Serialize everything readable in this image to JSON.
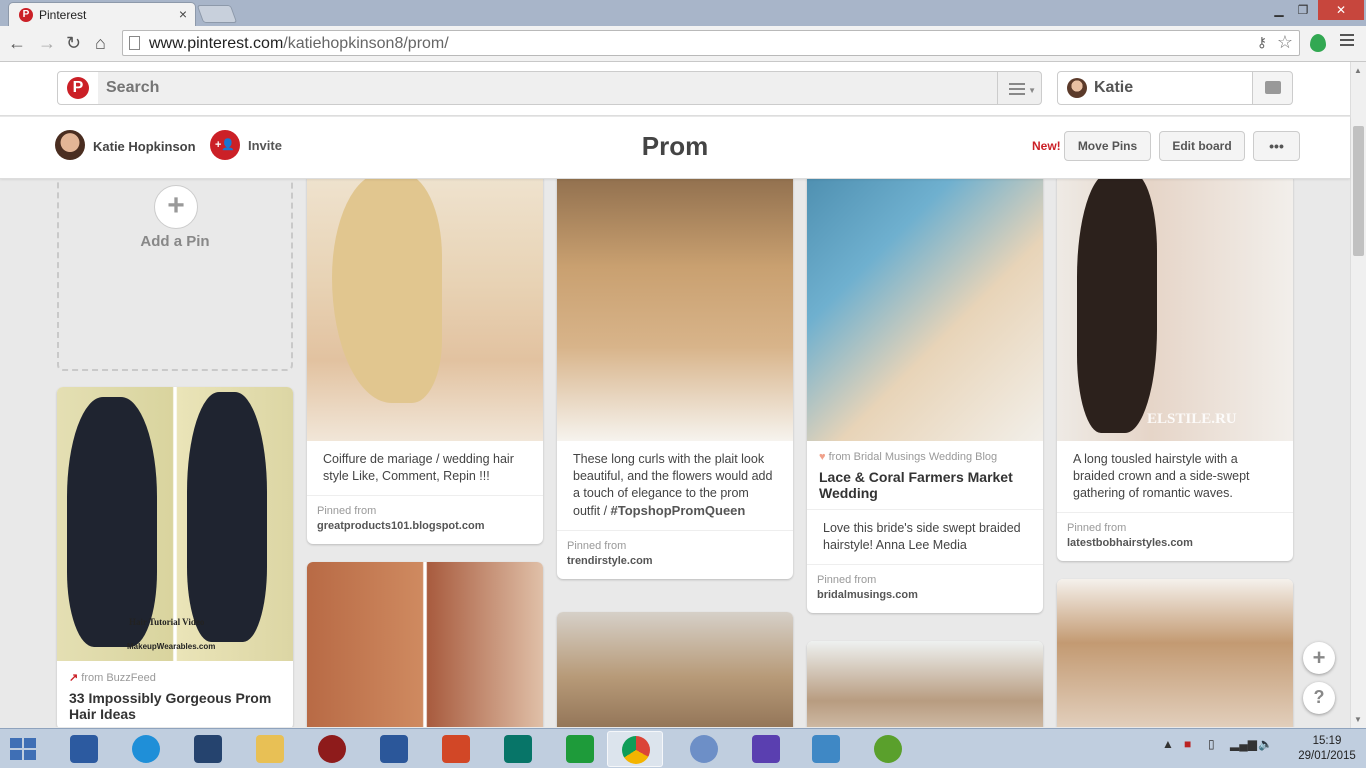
{
  "browser": {
    "tab_title": "Pinterest",
    "url_domain": "www.pinterest.com",
    "url_path": "/katiehopkinson8/prom/"
  },
  "header": {
    "search_placeholder": "Search",
    "user_name": "Katie"
  },
  "board": {
    "owner_name": "Katie Hopkinson",
    "invite_label": "Invite",
    "title": "Prom",
    "new_label": "New!",
    "move_pins_label": "Move Pins",
    "edit_board_label": "Edit board",
    "more_label": "•••"
  },
  "add_pin_label": "Add a Pin",
  "pins": [
    {
      "from_label": "from BuzzFeed",
      "title": "33 Impossibly Gorgeous Prom Hair Ideas",
      "image_caption_1": "Hair Tutorial Video",
      "image_caption_2": "MakeupWearables.com"
    },
    {
      "description": "Coiffure de mariage / wedding hair style Like, Comment, Repin !!!",
      "pinned_from_label": "Pinned from",
      "source": "greatproducts101.blogspot.com"
    },
    {
      "description": "These long curls with the plait look beautiful, and the flowers would add a touch of elegance to the prom outfit / ",
      "hashtag": "#TopshopPromQueen",
      "pinned_from_label": "Pinned from",
      "source": "trendirstyle.com"
    },
    {
      "from_label": "from Bridal Musings Wedding Blog",
      "title": "Lace & Coral Farmers Market Wedding",
      "description": "Love this bride's side swept braided hairstyle! Anna Lee Media",
      "pinned_from_label": "Pinned from",
      "source": "bridalmusings.com"
    },
    {
      "description": "A long tousled hairstyle with a braided crown and a side-swept gathering of romantic waves.",
      "pinned_from_label": "Pinned from",
      "source": "latestbobhairstyles.com",
      "watermark": "ELSTILE.RU"
    }
  ],
  "float_buttons": {
    "add": "+",
    "help": "?"
  },
  "taskbar": {
    "time": "15:19",
    "date": "29/01/2015"
  },
  "colors": {
    "pinterest_red": "#cb2027",
    "taskbar": "#c0cedf"
  }
}
